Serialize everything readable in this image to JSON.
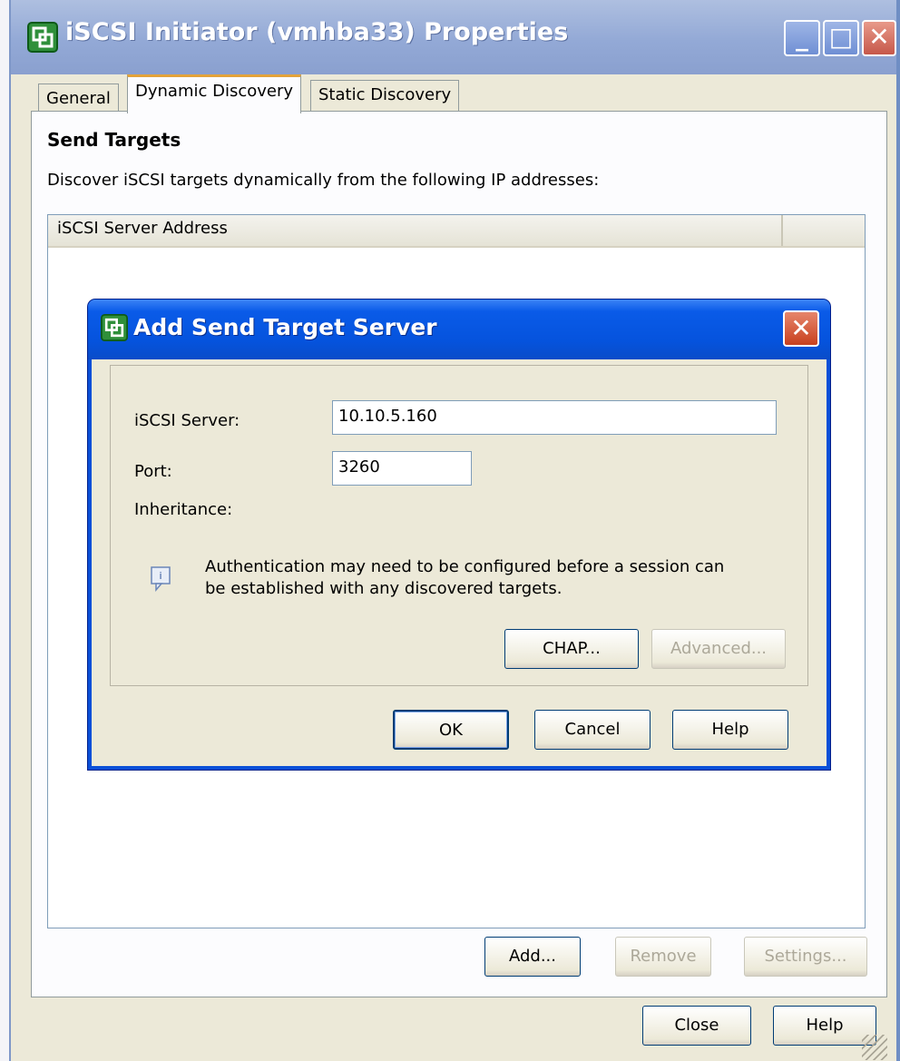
{
  "window": {
    "title": "iSCSI Initiator (vmhba33) Properties",
    "tabs": [
      {
        "label": "General"
      },
      {
        "label": "Dynamic Discovery"
      },
      {
        "label": "Static Discovery"
      }
    ],
    "active_tab": "Dynamic Discovery"
  },
  "send_targets": {
    "heading": "Send Targets",
    "description": "Discover iSCSI targets dynamically from the following IP addresses:",
    "columns": [
      "iSCSI Server Address",
      ""
    ]
  },
  "list_buttons": {
    "add": "Add...",
    "remove": "Remove",
    "settings": "Settings..."
  },
  "footer_buttons": {
    "close": "Close",
    "help": "Help"
  },
  "dialog": {
    "title": "Add Send Target Server",
    "server_label": "iSCSI Server:",
    "server_value": "10.10.5.160",
    "port_label": "Port:",
    "port_value": "3260",
    "inheritance_label": "Inheritance:",
    "info_line1": "Authentication may need to be configured before a session can",
    "info_line2": "be established with any discovered targets.",
    "chap": "CHAP...",
    "advanced": "Advanced...",
    "ok": "OK",
    "cancel": "Cancel",
    "help": "Help"
  },
  "colors": {
    "dialog_title_bar": "#0553dd",
    "inactive_title_bar": "#93a9d6",
    "window_face": "#ece9d8",
    "close_button": "#c8401e"
  },
  "icons": {
    "window": "vmware-vsphere-icon",
    "dialog": "vmware-vsphere-icon",
    "info": "info-note-icon"
  }
}
